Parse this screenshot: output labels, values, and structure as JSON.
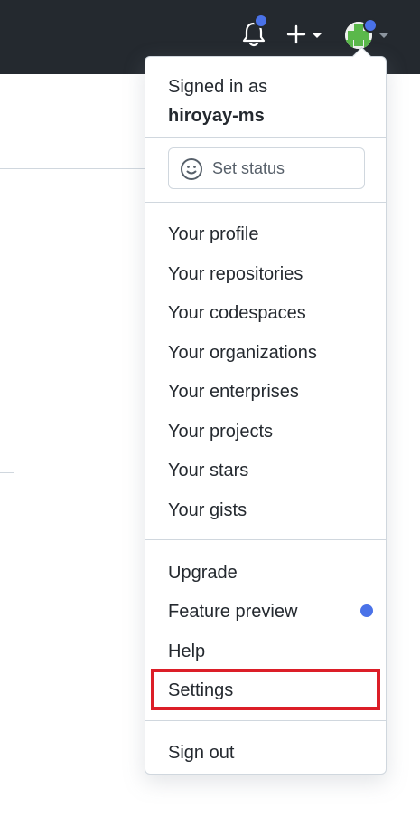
{
  "topbar": {
    "notification_icon": "bell-icon",
    "create_icon": "plus-icon",
    "avatar_icon": "avatar-icon",
    "unread_indicator_color": "#4a72e8"
  },
  "dropdown": {
    "signed_in_label": "Signed in as",
    "username": "hiroyay-ms",
    "set_status_label": "Set status",
    "set_status_icon": "smiley-icon",
    "section1": [
      "Your profile",
      "Your repositories",
      "Your codespaces",
      "Your organizations",
      "Your enterprises",
      "Your projects",
      "Your stars",
      "Your gists"
    ],
    "section2": [
      "Upgrade",
      "Feature preview",
      "Help",
      "Settings"
    ],
    "sign_out_label": "Sign out",
    "highlighted_item": "Settings",
    "highlight_color": "#dc1e28"
  }
}
